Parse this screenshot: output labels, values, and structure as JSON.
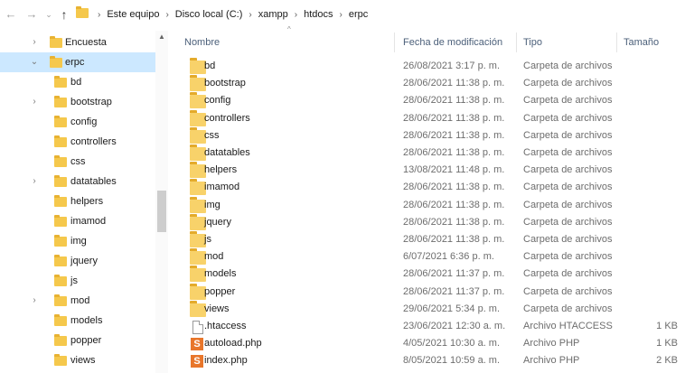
{
  "address": {
    "crumbs": [
      "Este equipo",
      "Disco local (C:)",
      "xampp",
      "htdocs",
      "erpc"
    ]
  },
  "nav": {
    "items": [
      {
        "label": "Encuesta",
        "chevron": "›"
      },
      {
        "label": "erpc",
        "chevron": "⌄",
        "selected": true
      },
      {
        "label": "bd",
        "chevron": ""
      },
      {
        "label": "bootstrap",
        "chevron": "›"
      },
      {
        "label": "config",
        "chevron": ""
      },
      {
        "label": "controllers",
        "chevron": ""
      },
      {
        "label": "css",
        "chevron": ""
      },
      {
        "label": "datatables",
        "chevron": "›"
      },
      {
        "label": "helpers",
        "chevron": ""
      },
      {
        "label": "imamod",
        "chevron": ""
      },
      {
        "label": "img",
        "chevron": ""
      },
      {
        "label": "jquery",
        "chevron": ""
      },
      {
        "label": "js",
        "chevron": ""
      },
      {
        "label": "mod",
        "chevron": "›"
      },
      {
        "label": "models",
        "chevron": ""
      },
      {
        "label": "popper",
        "chevron": ""
      },
      {
        "label": "views",
        "chevron": ""
      }
    ]
  },
  "columns": {
    "name": "Nombre",
    "date": "Fecha de modificación",
    "type": "Tipo",
    "size": "Tamaño"
  },
  "files": [
    {
      "name": "bd",
      "date": "26/08/2021 3:17 p. m.",
      "type": "Carpeta de archivos",
      "size": "",
      "icon": "folder-icon"
    },
    {
      "name": "bootstrap",
      "date": "28/06/2021 11:38 p. m.",
      "type": "Carpeta de archivos",
      "size": "",
      "icon": "folder-icon"
    },
    {
      "name": "config",
      "date": "28/06/2021 11:38 p. m.",
      "type": "Carpeta de archivos",
      "size": "",
      "icon": "folder-icon"
    },
    {
      "name": "controllers",
      "date": "28/06/2021 11:38 p. m.",
      "type": "Carpeta de archivos",
      "size": "",
      "icon": "folder-icon"
    },
    {
      "name": "css",
      "date": "28/06/2021 11:38 p. m.",
      "type": "Carpeta de archivos",
      "size": "",
      "icon": "folder-icon"
    },
    {
      "name": "datatables",
      "date": "28/06/2021 11:38 p. m.",
      "type": "Carpeta de archivos",
      "size": "",
      "icon": "folder-icon"
    },
    {
      "name": "helpers",
      "date": "13/08/2021 11:48 p. m.",
      "type": "Carpeta de archivos",
      "size": "",
      "icon": "folder-icon"
    },
    {
      "name": "imamod",
      "date": "28/06/2021 11:38 p. m.",
      "type": "Carpeta de archivos",
      "size": "",
      "icon": "folder-icon"
    },
    {
      "name": "img",
      "date": "28/06/2021 11:38 p. m.",
      "type": "Carpeta de archivos",
      "size": "",
      "icon": "folder-icon"
    },
    {
      "name": "jquery",
      "date": "28/06/2021 11:38 p. m.",
      "type": "Carpeta de archivos",
      "size": "",
      "icon": "folder-icon"
    },
    {
      "name": "js",
      "date": "28/06/2021 11:38 p. m.",
      "type": "Carpeta de archivos",
      "size": "",
      "icon": "folder-icon"
    },
    {
      "name": "mod",
      "date": "6/07/2021 6:36 p. m.",
      "type": "Carpeta de archivos",
      "size": "",
      "icon": "folder-icon"
    },
    {
      "name": "models",
      "date": "28/06/2021 11:37 p. m.",
      "type": "Carpeta de archivos",
      "size": "",
      "icon": "folder-icon"
    },
    {
      "name": "popper",
      "date": "28/06/2021 11:37 p. m.",
      "type": "Carpeta de archivos",
      "size": "",
      "icon": "folder-icon"
    },
    {
      "name": "views",
      "date": "29/06/2021 5:34 p. m.",
      "type": "Carpeta de archivos",
      "size": "",
      "icon": "folder-icon"
    },
    {
      "name": ".htaccess",
      "date": "23/06/2021 12:30 a. m.",
      "type": "Archivo HTACCESS",
      "size": "1 KB",
      "icon": "document-icon"
    },
    {
      "name": "autoload.php",
      "date": "4/05/2021 10:30 a. m.",
      "type": "Archivo PHP",
      "size": "1 KB",
      "icon": "php-file-icon"
    },
    {
      "name": "index.php",
      "date": "8/05/2021 10:59 a. m.",
      "type": "Archivo PHP",
      "size": "2 KB",
      "icon": "php-file-icon"
    }
  ]
}
